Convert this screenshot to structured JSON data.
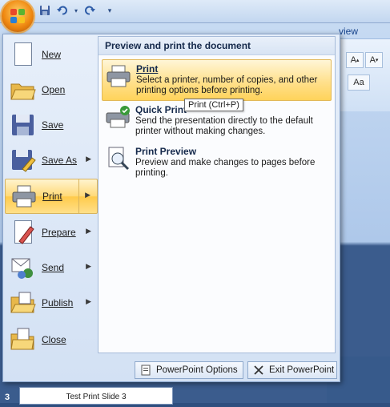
{
  "qat": {
    "icons": [
      "save-icon",
      "undo-icon",
      "redo-icon",
      "customize-icon"
    ]
  },
  "ribbon": {
    "partial_tab": "view"
  },
  "menu": {
    "items": [
      {
        "label": "New",
        "icon": "new-document-icon",
        "has_submenu": false
      },
      {
        "label": "Open",
        "icon": "open-folder-icon",
        "has_submenu": false
      },
      {
        "label": "Save",
        "icon": "save-disk-icon",
        "has_submenu": false
      },
      {
        "label": "Save As",
        "icon": "save-as-icon",
        "has_submenu": true
      },
      {
        "label": "Print",
        "icon": "printer-icon",
        "has_submenu": true,
        "selected": true
      },
      {
        "label": "Prepare",
        "icon": "prepare-icon",
        "has_submenu": true
      },
      {
        "label": "Send",
        "icon": "send-icon",
        "has_submenu": true
      },
      {
        "label": "Publish",
        "icon": "publish-icon",
        "has_submenu": true
      },
      {
        "label": "Close",
        "icon": "close-folder-icon",
        "has_submenu": false
      }
    ],
    "submenu": {
      "heading": "Preview and print the document",
      "items": [
        {
          "title": "Print",
          "description": "Select a printer, number of copies, and other printing options before printing.",
          "icon": "print-dialog-icon",
          "highlighted": true
        },
        {
          "title": "Quick Print",
          "description": "Send the presentation directly to the default printer without making changes.",
          "icon": "quick-print-icon"
        },
        {
          "title": "Print Preview",
          "description": "Preview and make changes to pages before printing.",
          "icon": "print-preview-icon"
        }
      ],
      "tooltip": "Print (Ctrl+P)"
    },
    "bottom_buttons": {
      "options_label": "PowerPoint Options",
      "exit_label": "Exit PowerPoint"
    }
  },
  "status": {
    "slide_number": "3",
    "slide_caption": "Test Print Slide 3"
  },
  "colors": {
    "accent": "#ffd35a",
    "menu_bg": "#dde8f6",
    "frame": "#3b5c8d"
  }
}
